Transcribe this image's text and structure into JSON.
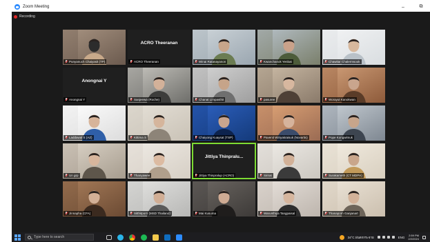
{
  "window": {
    "title": "Zoom Meeting",
    "minimize": "–",
    "maximize": "⧉",
    "recording": "Recording"
  },
  "participants": [
    {
      "name": "Punyanuch Chaiyasit (TP)",
      "type": "video",
      "scene": "sofa"
    },
    {
      "name": "ACRO Theeranan",
      "type": "avatar",
      "display": "ACRO Theeranan"
    },
    {
      "name": "Winai Ratanayanon",
      "type": "video",
      "scene": "office",
      "speaking": false
    },
    {
      "name": "Kwanchanok Yenbat",
      "type": "video",
      "scene": "outdoor"
    },
    {
      "name": "Chawitar Chalermsook",
      "type": "video",
      "scene": "light"
    },
    {
      "name": "Anongnai Y",
      "type": "avatar",
      "display": "Anongnai Y"
    },
    {
      "name": "Sanjeewa (Roche)",
      "type": "video",
      "scene": "window"
    },
    {
      "name": "Chanat Limpasthit",
      "type": "video",
      "scene": "grey"
    },
    {
      "name": "pasuree",
      "type": "video",
      "scene": "portrait"
    },
    {
      "name": "Worayut Kanokwan",
      "type": "video",
      "scene": "warm"
    },
    {
      "name": "Laddawal S (AZ)",
      "type": "video",
      "scene": "bright"
    },
    {
      "name": "Kittima S",
      "type": "video",
      "scene": "plain"
    },
    {
      "name": "Chaiyong Kuaysat (TSP)",
      "type": "video",
      "scene": "blue"
    },
    {
      "name": "Pavenit Wiriyakraisuk (Novartis)",
      "type": "video",
      "scene": "sunset"
    },
    {
      "name": "Pope Kongwimuk",
      "type": "video",
      "scene": "office2"
    },
    {
      "name": "Un grp",
      "type": "video",
      "scene": "room"
    },
    {
      "name": "Thanyawee",
      "type": "video",
      "scene": "plain2"
    },
    {
      "name": "Jittiya Thinpralup (ACRO)",
      "type": "avatar",
      "display": "Jittiya Thinpralu...",
      "speaking": true
    },
    {
      "name": "Sirirat",
      "type": "video",
      "scene": "light2"
    },
    {
      "name": "Surakameth (CT MDPH)",
      "type": "video",
      "scene": "cream"
    },
    {
      "name": "Jinnapha (CFA)",
      "type": "video",
      "scene": "wood"
    },
    {
      "name": "Sitthitporn (MSD Thailand)",
      "type": "video",
      "scene": "grey2"
    },
    {
      "name": "Mai Kusuma",
      "type": "video",
      "scene": "dark"
    },
    {
      "name": "Warunthiya Tangpaisal",
      "type": "video",
      "scene": "soft"
    },
    {
      "name": "Thanaporn Ganjanart",
      "type": "video",
      "scene": "beige"
    }
  ],
  "taskbar": {
    "search_placeholder": "Type here to search",
    "weather": "34°C ฝนตกกระจาย",
    "language": "ENG",
    "time": "2:59 PM",
    "date": "2/2/2024"
  },
  "colors": {
    "speaking_outline": "#7ddc33",
    "mic_muted": "#e02828",
    "zoom_blue": "#2d8cff"
  }
}
